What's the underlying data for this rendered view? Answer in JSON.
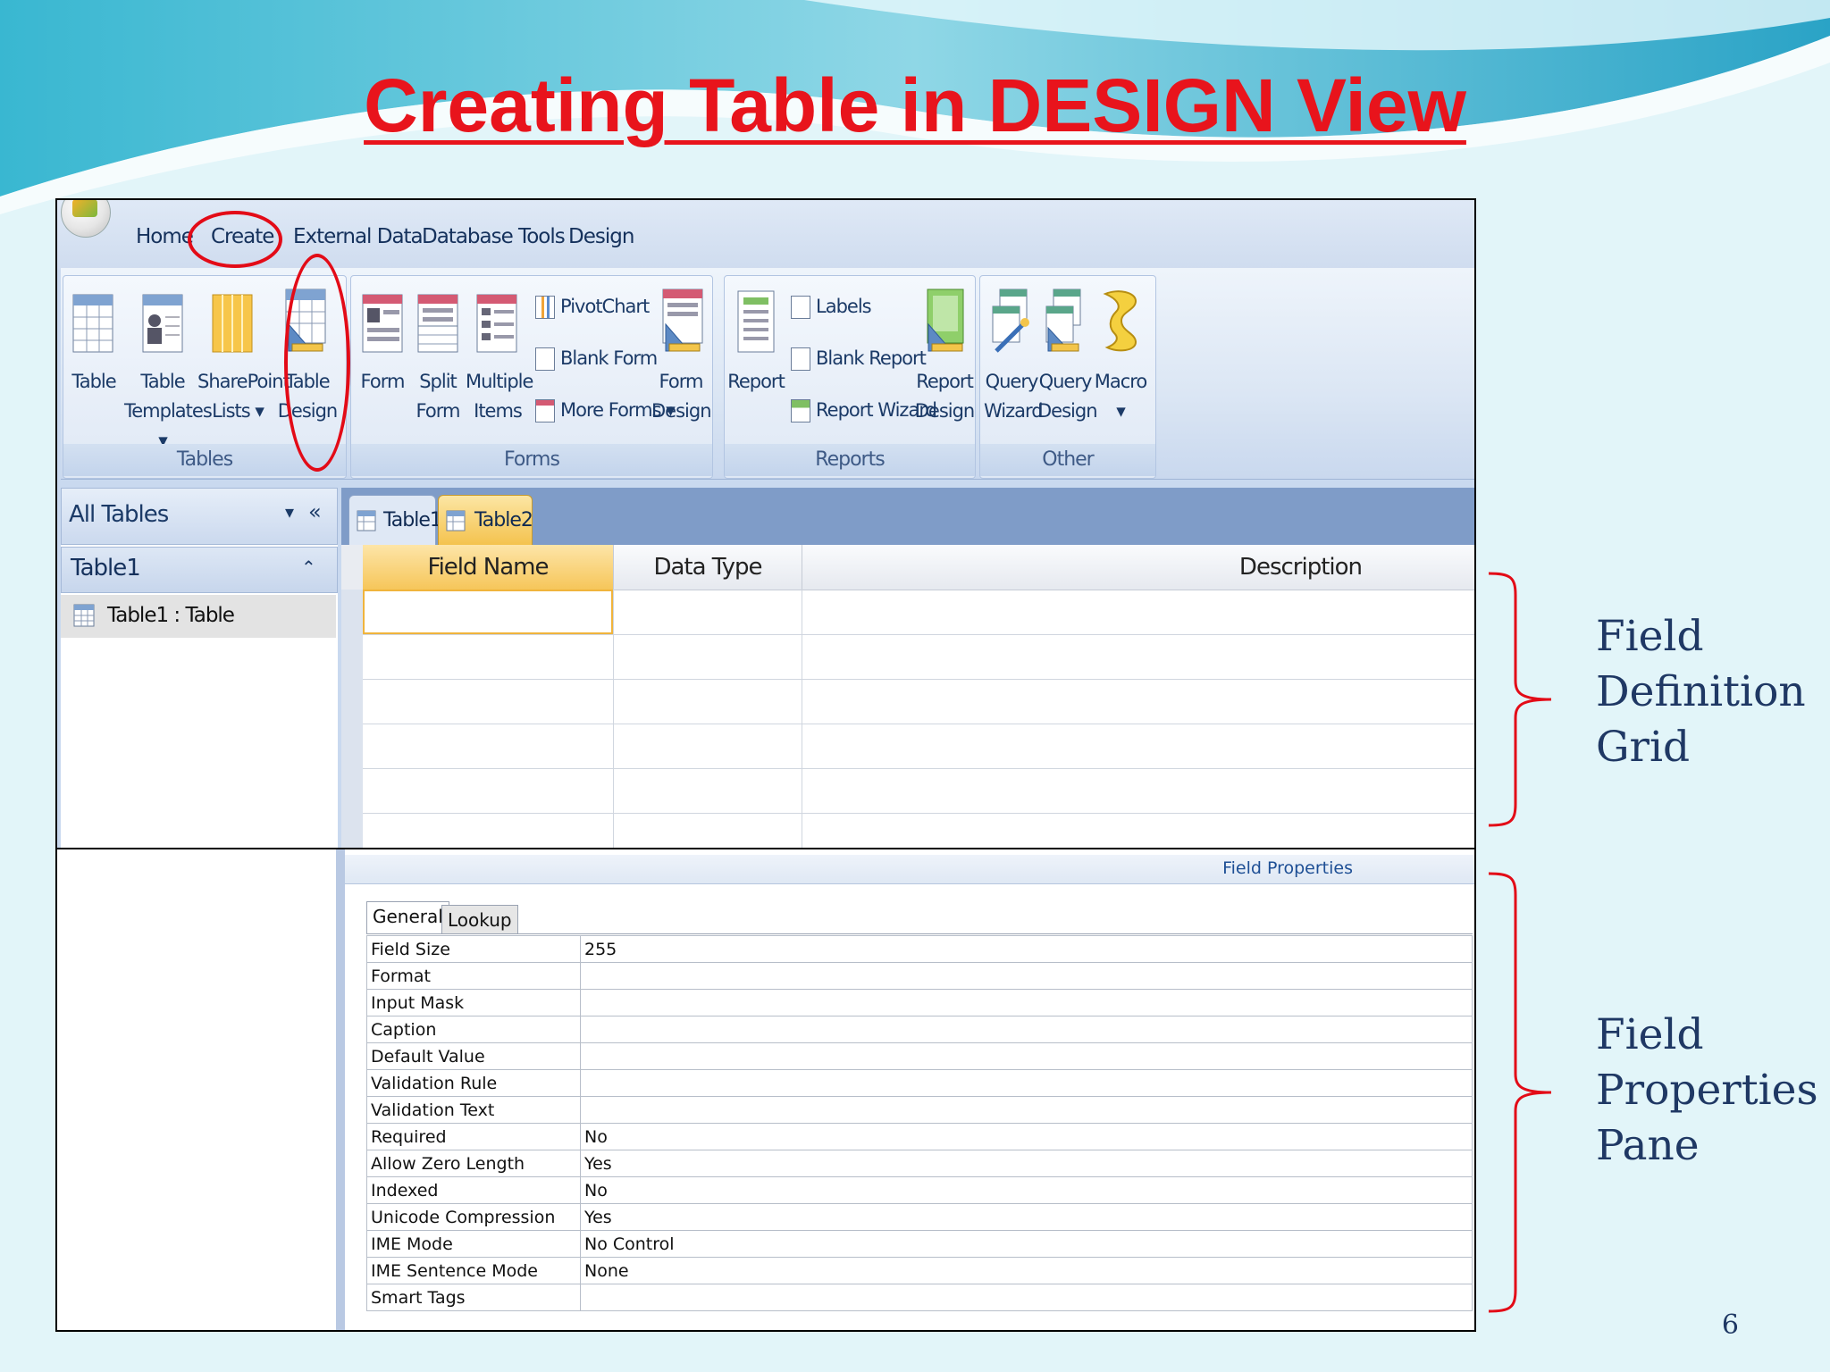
{
  "slide": {
    "title": "Creating Table in DESIGN View",
    "page_number": "6",
    "annotations": {
      "grid": [
        "Field",
        "Definition",
        "Grid"
      ],
      "pane": [
        "Field",
        "Properties",
        "Pane"
      ]
    },
    "colors": {
      "title": "#e8141c",
      "annotation": "#1f3864",
      "highlight": "#e30b17"
    }
  },
  "ribbon_tabs": [
    "Home",
    "Create",
    "External Data",
    "Database Tools",
    "Design"
  ],
  "ribbon": {
    "tables": {
      "label": "Tables",
      "buttons": [
        {
          "line1": "Table",
          "line2": ""
        },
        {
          "line1": "Table",
          "line2": "Templates ▾"
        },
        {
          "line1": "SharePoint",
          "line2": "Lists ▾"
        },
        {
          "line1": "Table",
          "line2": "Design"
        }
      ]
    },
    "forms": {
      "label": "Forms",
      "buttons": [
        {
          "line1": "Form",
          "line2": ""
        },
        {
          "line1": "Split",
          "line2": "Form"
        },
        {
          "line1": "Multiple",
          "line2": "Items"
        }
      ],
      "small": [
        "PivotChart",
        "Blank Form",
        "More Forms ▾"
      ],
      "form_design": {
        "line1": "Form",
        "line2": "Design"
      }
    },
    "reports": {
      "label": "Reports",
      "report": "Report",
      "small": [
        "Labels",
        "Blank Report",
        "Report Wizard"
      ],
      "report_design": {
        "line1": "Report",
        "line2": "Design"
      }
    },
    "other": {
      "label": "Other",
      "buttons": [
        {
          "line1": "Query",
          "line2": "Wizard"
        },
        {
          "line1": "Query",
          "line2": "Design"
        },
        {
          "line1": "Macro",
          "line2": "▾"
        }
      ]
    }
  },
  "nav_pane": {
    "header": "All Tables",
    "group": "Table1",
    "item": "Table1 : Table"
  },
  "doc_tabs": [
    "Table1",
    "Table2"
  ],
  "grid": {
    "columns": [
      "Field Name",
      "Data Type",
      "Description"
    ]
  },
  "field_properties": {
    "title": "Field Properties",
    "tabs": [
      "General",
      "Lookup"
    ],
    "rows": [
      {
        "name": "Field Size",
        "value": "255"
      },
      {
        "name": "Format",
        "value": ""
      },
      {
        "name": "Input Mask",
        "value": ""
      },
      {
        "name": "Caption",
        "value": ""
      },
      {
        "name": "Default Value",
        "value": ""
      },
      {
        "name": "Validation Rule",
        "value": ""
      },
      {
        "name": "Validation Text",
        "value": ""
      },
      {
        "name": "Required",
        "value": "No"
      },
      {
        "name": "Allow Zero Length",
        "value": "Yes"
      },
      {
        "name": "Indexed",
        "value": "No"
      },
      {
        "name": "Unicode Compression",
        "value": "Yes"
      },
      {
        "name": "IME Mode",
        "value": "No Control"
      },
      {
        "name": "IME Sentence Mode",
        "value": "None"
      },
      {
        "name": "Smart Tags",
        "value": ""
      }
    ]
  }
}
